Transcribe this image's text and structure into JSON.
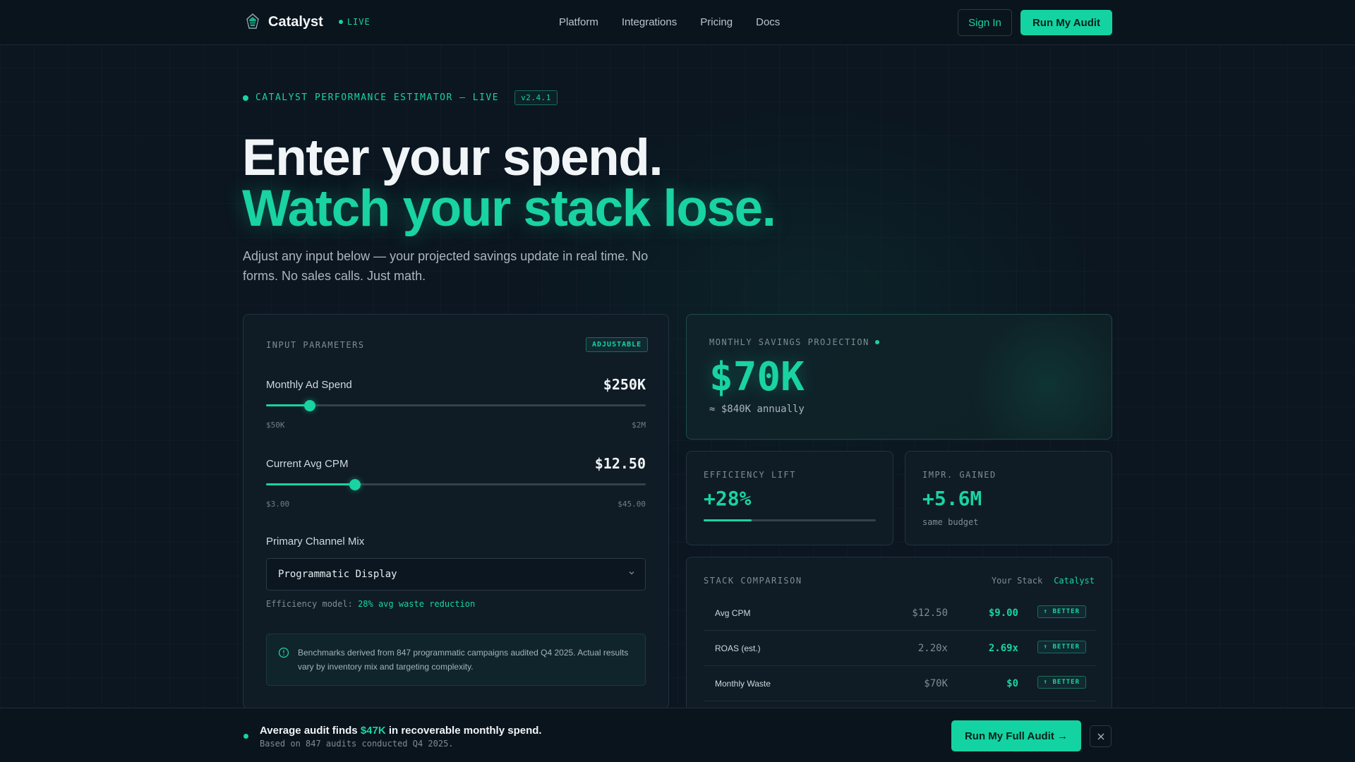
{
  "nav": {
    "brand": "Catalyst",
    "live": "LIVE",
    "links": [
      "Platform",
      "Integrations",
      "Pricing",
      "Docs"
    ],
    "sign_in": "Sign In",
    "cta": "Run My Audit"
  },
  "hero": {
    "eyebrow": "CATALYST PERFORMANCE ESTIMATOR — LIVE",
    "version": "v2.4.1",
    "title_line1": "Enter your spend.",
    "title_line2": "Watch your stack lose.",
    "subtitle": "Adjust any input below — your projected savings update in real time. No forms. No sales calls. Just math."
  },
  "inputs": {
    "label": "INPUT PARAMETERS",
    "badge": "ADJUSTABLE",
    "ad_spend": {
      "label": "Monthly Ad Spend",
      "value": "$250K",
      "min": "$50K",
      "max": "$2M",
      "position": 0.115
    },
    "cpm": {
      "label": "Current Avg CPM",
      "value": "$12.50",
      "min": "$3.00",
      "max": "$45.00",
      "position": 0.234
    },
    "channel": {
      "label": "Primary Channel Mix",
      "selected": "Programmatic Display"
    },
    "efficiency_prefix": "Efficiency model:",
    "efficiency_value": "28% avg waste reduction",
    "note": "Benchmarks derived from 847 programmatic campaigns audited Q4 2025. Actual results vary by inventory mix and targeting complexity."
  },
  "savings": {
    "label": "MONTHLY SAVINGS PROJECTION",
    "value": "$70K",
    "annual": "≈ $840K annually"
  },
  "efficiency": {
    "label": "EFFICIENCY LIFT",
    "value": "+28%",
    "progress": 0.28
  },
  "impressions": {
    "label": "IMPR. GAINED",
    "value": "+5.6M",
    "sub": "same budget"
  },
  "comparison": {
    "label": "STACK COMPARISON",
    "col_yours": "Your Stack",
    "col_catalyst": "Catalyst",
    "rows": [
      {
        "name": "Avg CPM",
        "yours": "$12.50",
        "catalyst": "$9.00",
        "badge": "↑ BETTER"
      },
      {
        "name": "ROAS (est.)",
        "yours": "2.20x",
        "catalyst": "2.69x",
        "badge": "↑ BETTER"
      },
      {
        "name": "Monthly Waste",
        "yours": "$70K",
        "catalyst": "$0",
        "badge": "↑ BETTER"
      }
    ]
  },
  "banner": {
    "prefix": "Average audit finds ",
    "amount": "$47K",
    "suffix": " in recoverable monthly spend.",
    "sub": "Based on 847 audits conducted Q4 2025.",
    "cta": "Run My Full Audit →"
  },
  "colors": {
    "accent": "#19d3a2",
    "background": "#0b1620",
    "card": "#0f1c26"
  }
}
